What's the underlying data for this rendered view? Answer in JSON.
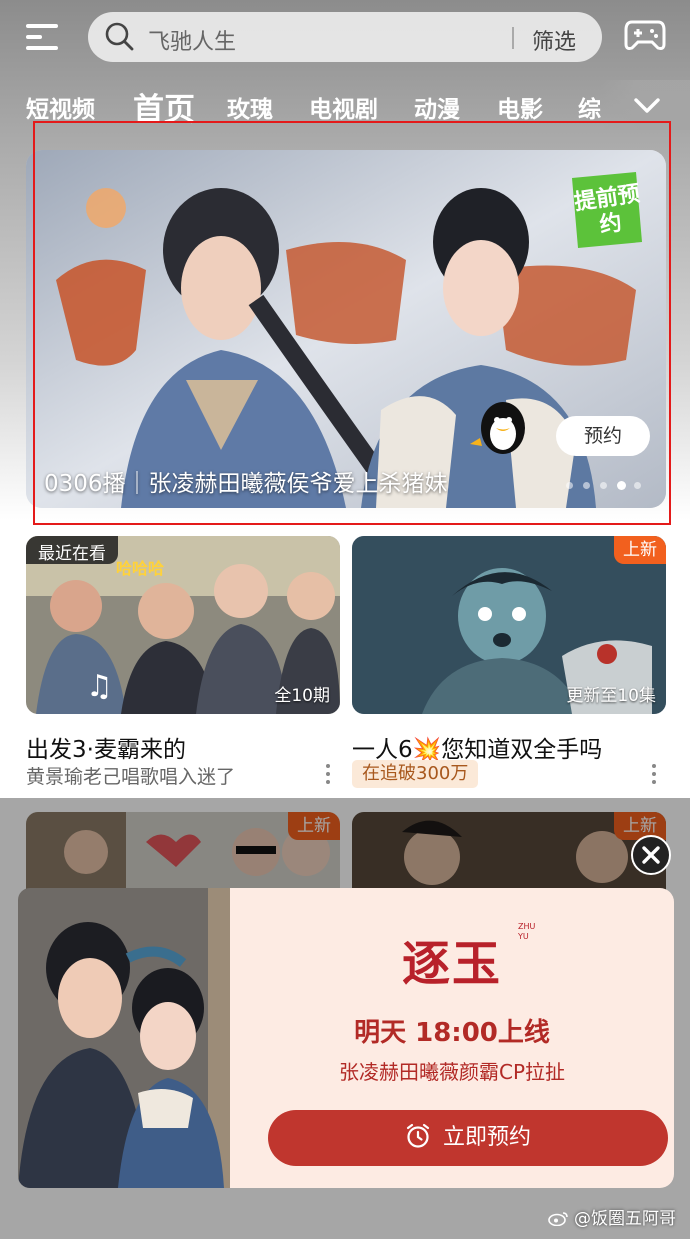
{
  "search": {
    "placeholder": "飞驰人生",
    "filter_label": "筛选"
  },
  "tabs": [
    "短视频",
    "首页",
    "玫瑰",
    "电视剧",
    "动漫",
    "电影",
    "综"
  ],
  "active_tab_index": 1,
  "banner": {
    "badge": "提前预约",
    "reserve_label": "预约",
    "caption": "0306播｜张凌赫田曦薇侯爷爱上杀猪妹",
    "slide_count": 5,
    "active_slide": 3
  },
  "cards": [
    {
      "corner_tag": "最近在看",
      "episode_tag": "全10期",
      "title": "出发3·麦霸来的",
      "subtitle": "黄景瑜老己唱歌唱入迷了"
    },
    {
      "corner_tag": "上新",
      "episode_tag": "更新至10集",
      "title": "一人6💥您知道双全手吗",
      "subtitle": "在追破300万"
    },
    {
      "corner_tag": "上新"
    },
    {
      "corner_tag": "上新"
    }
  ],
  "popup": {
    "logo": "逐玉",
    "logo_pinyin": "ZHU YU",
    "line1": "明天 18:00上线",
    "line2": "张凌赫田曦薇颜霸CP拉扯",
    "button": "立即预约"
  },
  "watermark": "@饭圈五阿哥",
  "colors": {
    "accent_red": "#c0362e",
    "new_tag": "#f2601e",
    "popup_bg": "#fdebe3",
    "highlight": "#e41a1a"
  }
}
